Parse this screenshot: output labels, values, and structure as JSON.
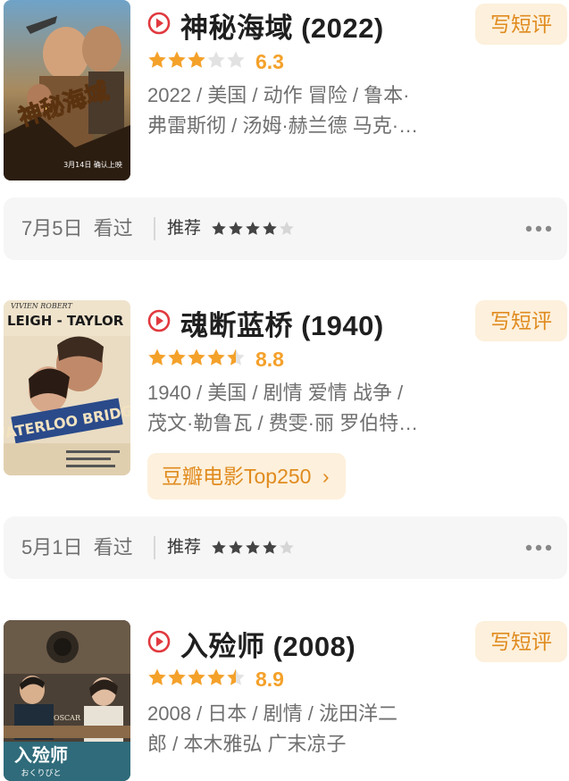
{
  "movies": [
    {
      "title": "神秘海域 (2022)",
      "rating_value": 6.3,
      "rating": "6.3",
      "stars_filled": 3,
      "info_line1": "2022 / 美国 / 动作 冒险 / 鲁本·",
      "info_line2": "弗雷斯彻 / 汤姆·赫兰德 马克·…",
      "review_label": "写短评",
      "poster_text": "神秘海域",
      "poster_date": "3月14日 确认上映",
      "seen_date": "7月5日",
      "seen_label": "看过",
      "recommend_label": "推荐",
      "recommend_stars": 4
    },
    {
      "title": "魂断蓝桥 (1940)",
      "rating_value": 8.8,
      "rating": "8.8",
      "stars_filled": 4.5,
      "info_line1": "1940 / 美国 / 剧情 爱情 战争 /",
      "info_line2": "茂文·勒鲁瓦 / 费雯·丽 罗伯特…",
      "review_label": "写短评",
      "tag": "豆瓣电影Top250",
      "poster_text1": "VIVIEN ROBERT",
      "poster_text2": "LEIGH - TAYLOR",
      "poster_title": "WATERLOO BRIDGE",
      "seen_date": "5月1日",
      "seen_label": "看过",
      "recommend_label": "推荐",
      "recommend_stars": 4
    },
    {
      "title": "入殓师 (2008)",
      "rating_value": 8.9,
      "rating": "8.9",
      "stars_filled": 4.5,
      "info_line1": "2008 / 日本 / 剧情 / 泷田洋二",
      "info_line2": "郎 / 本木雅弘 广末凉子",
      "review_label": "写短评",
      "poster_text": "入殓师",
      "poster_subtext": "おくりびと",
      "poster_badge": "OSCAR"
    }
  ],
  "colors": {
    "accent": "#f4a12a",
    "accent_text": "#e08b1e",
    "accent_bg": "#fdf0dc",
    "play_red": "#e0393e",
    "star_empty": "#e2e2e2",
    "rec_star": "#444444"
  }
}
